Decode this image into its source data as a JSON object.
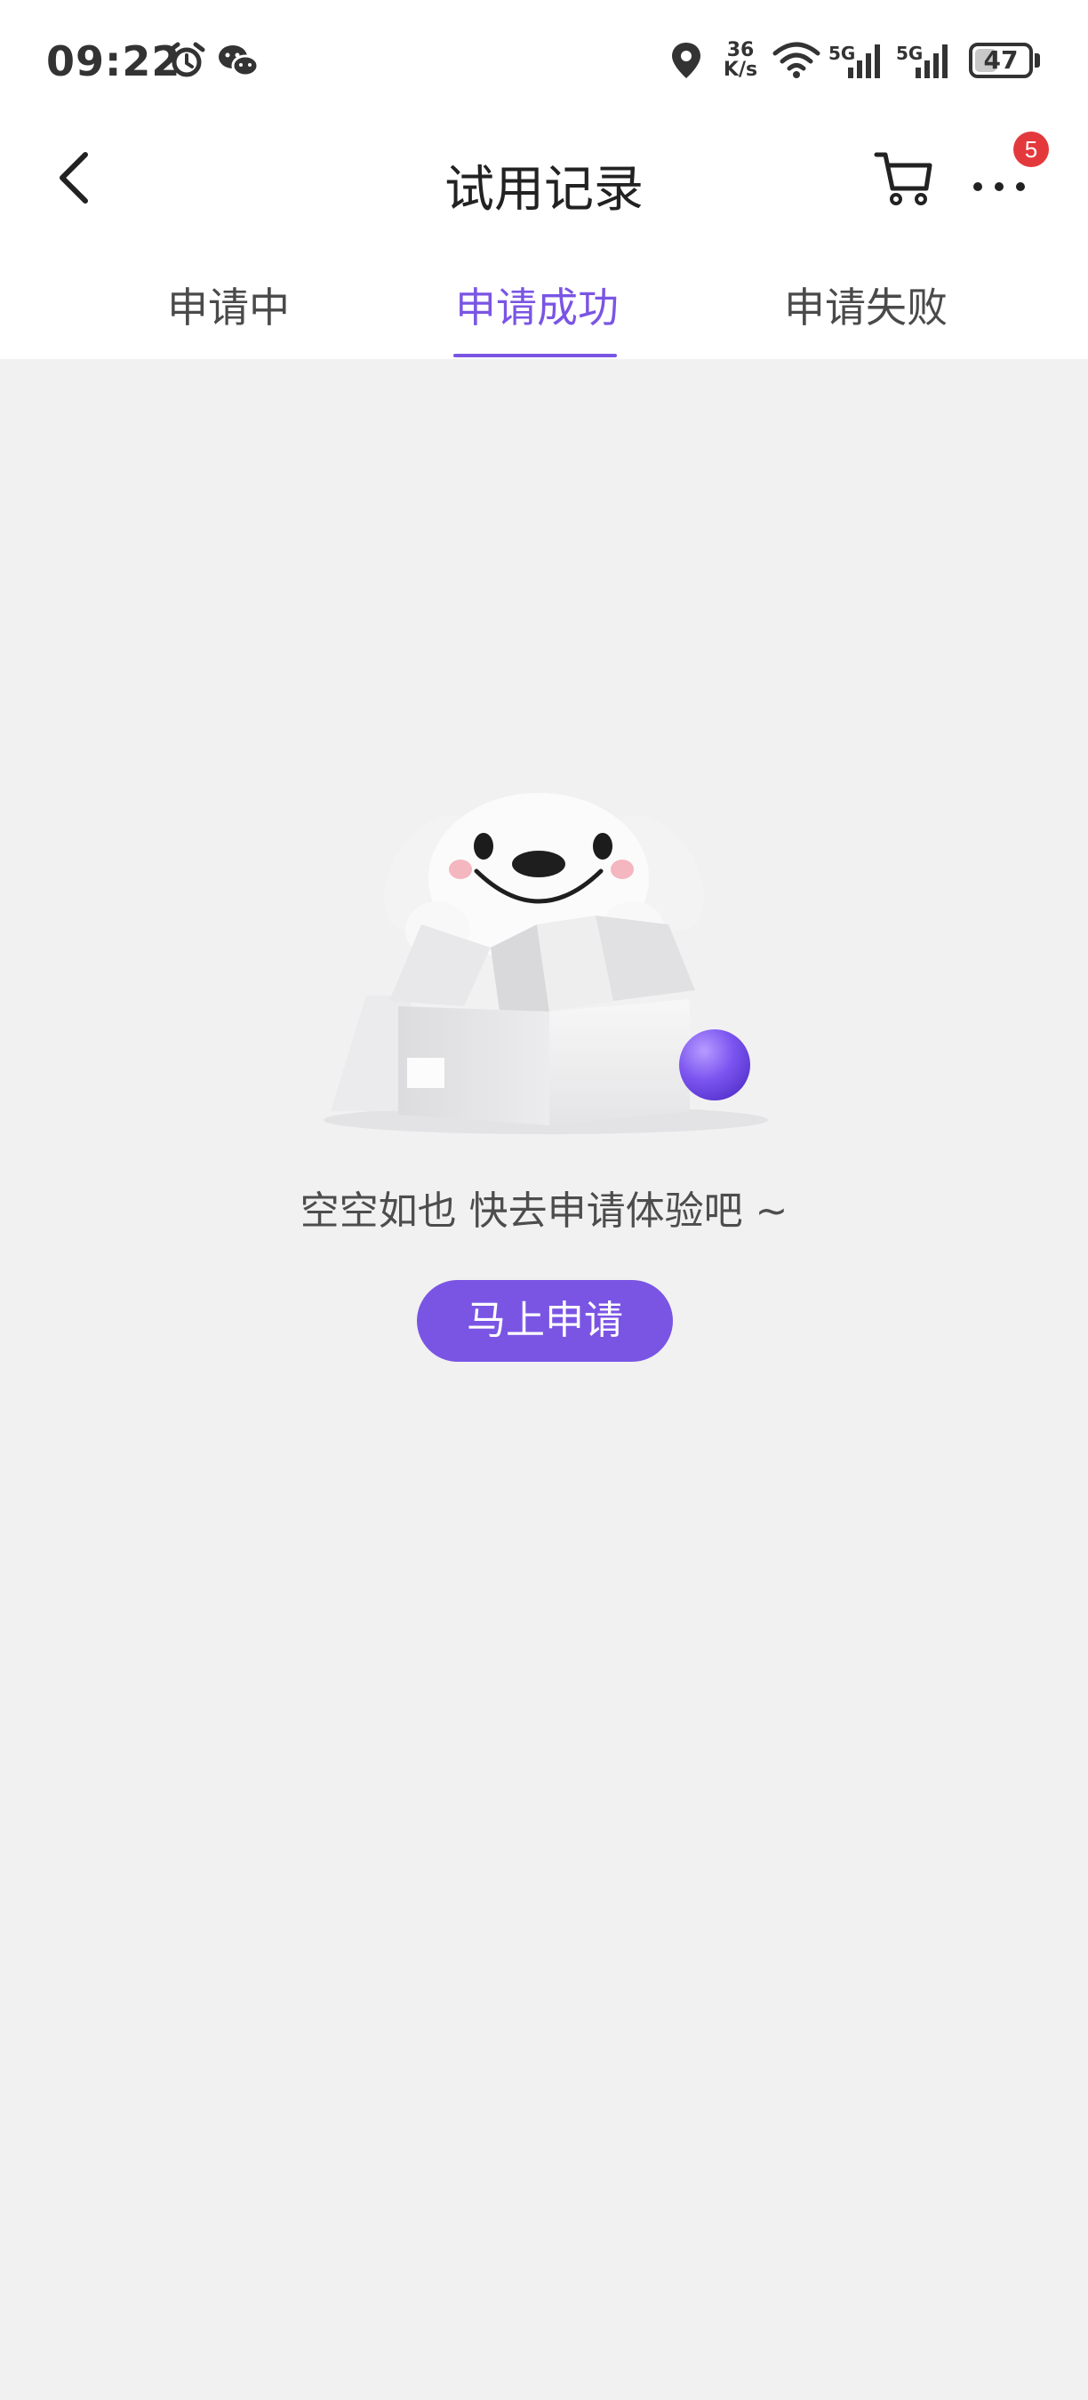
{
  "status_bar": {
    "time": "09:22",
    "net_speed_value": "36",
    "net_speed_unit": "K/s",
    "signal_1_label": "5G",
    "signal_2_label": "5G",
    "battery": "47",
    "battery_level": 0.47,
    "icons": [
      "alarm-icon",
      "wechat-icon",
      "location-icon",
      "wifi-icon",
      "signal-icon",
      "signal-icon",
      "battery-icon"
    ]
  },
  "nav": {
    "title": "试用记录",
    "cart_icon": "cart-icon",
    "more_icon": "more-icon",
    "back_icon": "chevron-left-icon",
    "badge_count": "5"
  },
  "tabs": [
    {
      "label": "申请中",
      "active": false
    },
    {
      "label": "申请成功",
      "active": true
    },
    {
      "label": "申请失败",
      "active": false
    }
  ],
  "empty_state": {
    "message": "空空如也 快去申请体验吧 ~",
    "button_label": "马上申请"
  },
  "colors": {
    "accent": "#7a55e4",
    "background": "#f1f1f2",
    "badge": "#e4393c"
  }
}
